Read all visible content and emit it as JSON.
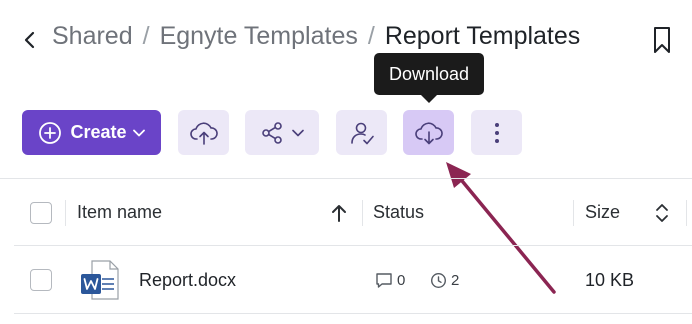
{
  "breadcrumb": {
    "items": [
      "Shared",
      "Egnyte Templates",
      "Report Templates"
    ],
    "separator": "/"
  },
  "toolbar": {
    "create_label": "Create",
    "tooltip": "Download"
  },
  "table": {
    "columns": [
      "Item name",
      "Status",
      "Size"
    ],
    "rows": [
      {
        "name": "Report.docx",
        "comments": "0",
        "versions": "2",
        "size": "10 KB"
      }
    ]
  },
  "colors": {
    "primary": "#6a44c8",
    "tool_bg": "#ece8f7",
    "tool_active_bg": "#d7c9f5",
    "arrow": "#8b2552",
    "word_blue": "#2b579a"
  },
  "icons": [
    "back-chevron-icon",
    "bookmark-icon",
    "plus-circle-icon",
    "chevron-down-icon",
    "cloud-upload-icon",
    "share-icon",
    "user-check-icon",
    "cloud-download-icon",
    "more-vertical-icon",
    "sort-up-icon",
    "sort-toggle-icon",
    "word-doc-icon",
    "comment-icon",
    "clock-icon"
  ]
}
